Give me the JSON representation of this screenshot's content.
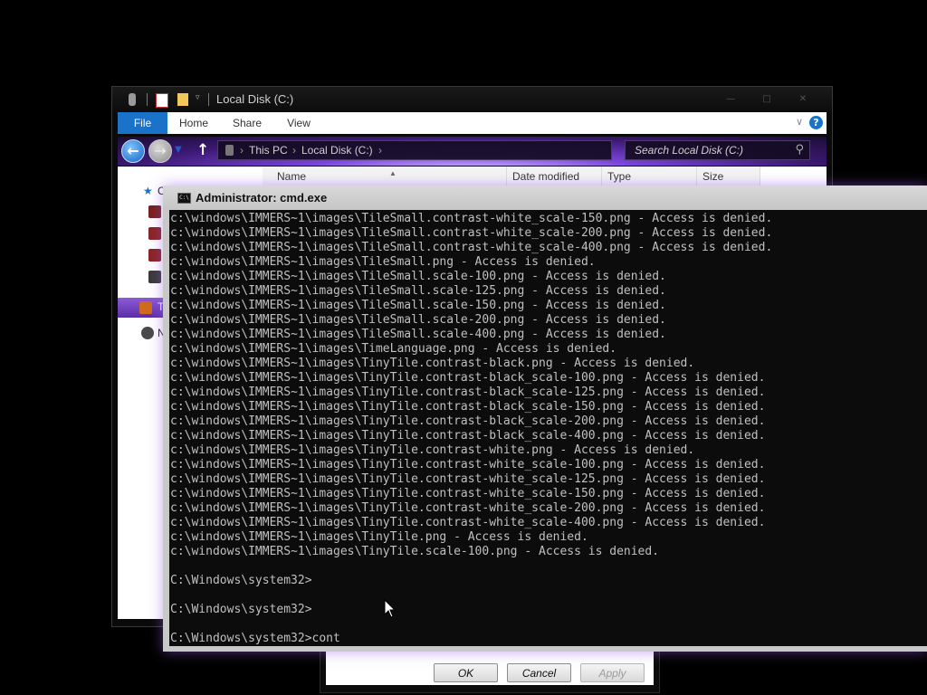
{
  "explorer": {
    "title": "Local Disk (C:)",
    "ribbon_tabs": [
      "File",
      "Home",
      "Share",
      "View"
    ],
    "help": "?",
    "breadcrumb": [
      "This PC",
      "Local Disk (C:)"
    ],
    "search_placeholder": "Search Local Disk (C:)",
    "columns": [
      "Name",
      "Date modified",
      "Type",
      "Size"
    ],
    "nav_fragments": [
      "C",
      "T",
      "N"
    ],
    "title_icons": [
      "pin-icon",
      "properties-icon",
      "folder-icon",
      "dropdown-icon"
    ]
  },
  "cmd": {
    "title": "Administrator: cmd.exe",
    "lines": [
      "c:\\windows\\IMMERS~1\\images\\TileSmall.contrast-white_scale-150.png - Access is denied.",
      "c:\\windows\\IMMERS~1\\images\\TileSmall.contrast-white_scale-200.png - Access is denied.",
      "c:\\windows\\IMMERS~1\\images\\TileSmall.contrast-white_scale-400.png - Access is denied.",
      "c:\\windows\\IMMERS~1\\images\\TileSmall.png - Access is denied.",
      "c:\\windows\\IMMERS~1\\images\\TileSmall.scale-100.png - Access is denied.",
      "c:\\windows\\IMMERS~1\\images\\TileSmall.scale-125.png - Access is denied.",
      "c:\\windows\\IMMERS~1\\images\\TileSmall.scale-150.png - Access is denied.",
      "c:\\windows\\IMMERS~1\\images\\TileSmall.scale-200.png - Access is denied.",
      "c:\\windows\\IMMERS~1\\images\\TileSmall.scale-400.png - Access is denied.",
      "c:\\windows\\IMMERS~1\\images\\TimeLanguage.png - Access is denied.",
      "c:\\windows\\IMMERS~1\\images\\TinyTile.contrast-black.png - Access is denied.",
      "c:\\windows\\IMMERS~1\\images\\TinyTile.contrast-black_scale-100.png - Access is denied.",
      "c:\\windows\\IMMERS~1\\images\\TinyTile.contrast-black_scale-125.png - Access is denied.",
      "c:\\windows\\IMMERS~1\\images\\TinyTile.contrast-black_scale-150.png - Access is denied.",
      "c:\\windows\\IMMERS~1\\images\\TinyTile.contrast-black_scale-200.png - Access is denied.",
      "c:\\windows\\IMMERS~1\\images\\TinyTile.contrast-black_scale-400.png - Access is denied.",
      "c:\\windows\\IMMERS~1\\images\\TinyTile.contrast-white.png - Access is denied.",
      "c:\\windows\\IMMERS~1\\images\\TinyTile.contrast-white_scale-100.png - Access is denied.",
      "c:\\windows\\IMMERS~1\\images\\TinyTile.contrast-white_scale-125.png - Access is denied.",
      "c:\\windows\\IMMERS~1\\images\\TinyTile.contrast-white_scale-150.png - Access is denied.",
      "c:\\windows\\IMMERS~1\\images\\TinyTile.contrast-white_scale-200.png - Access is denied.",
      "c:\\windows\\IMMERS~1\\images\\TinyTile.contrast-white_scale-400.png - Access is denied.",
      "c:\\windows\\IMMERS~1\\images\\TinyTile.png - Access is denied.",
      "c:\\windows\\IMMERS~1\\images\\TinyTile.scale-100.png - Access is denied.",
      "",
      "C:\\Windows\\system32>",
      "",
      "C:\\Windows\\system32>",
      "",
      "C:\\Windows\\system32>cont"
    ]
  },
  "dialog": {
    "ok": "OK",
    "cancel": "Cancel",
    "apply": "Apply"
  },
  "colors": {
    "accent": "#1a73c8",
    "theme_purple": "#7a43d8",
    "console_bg": "#0c0c0c",
    "console_text": "#c0c0c0"
  }
}
